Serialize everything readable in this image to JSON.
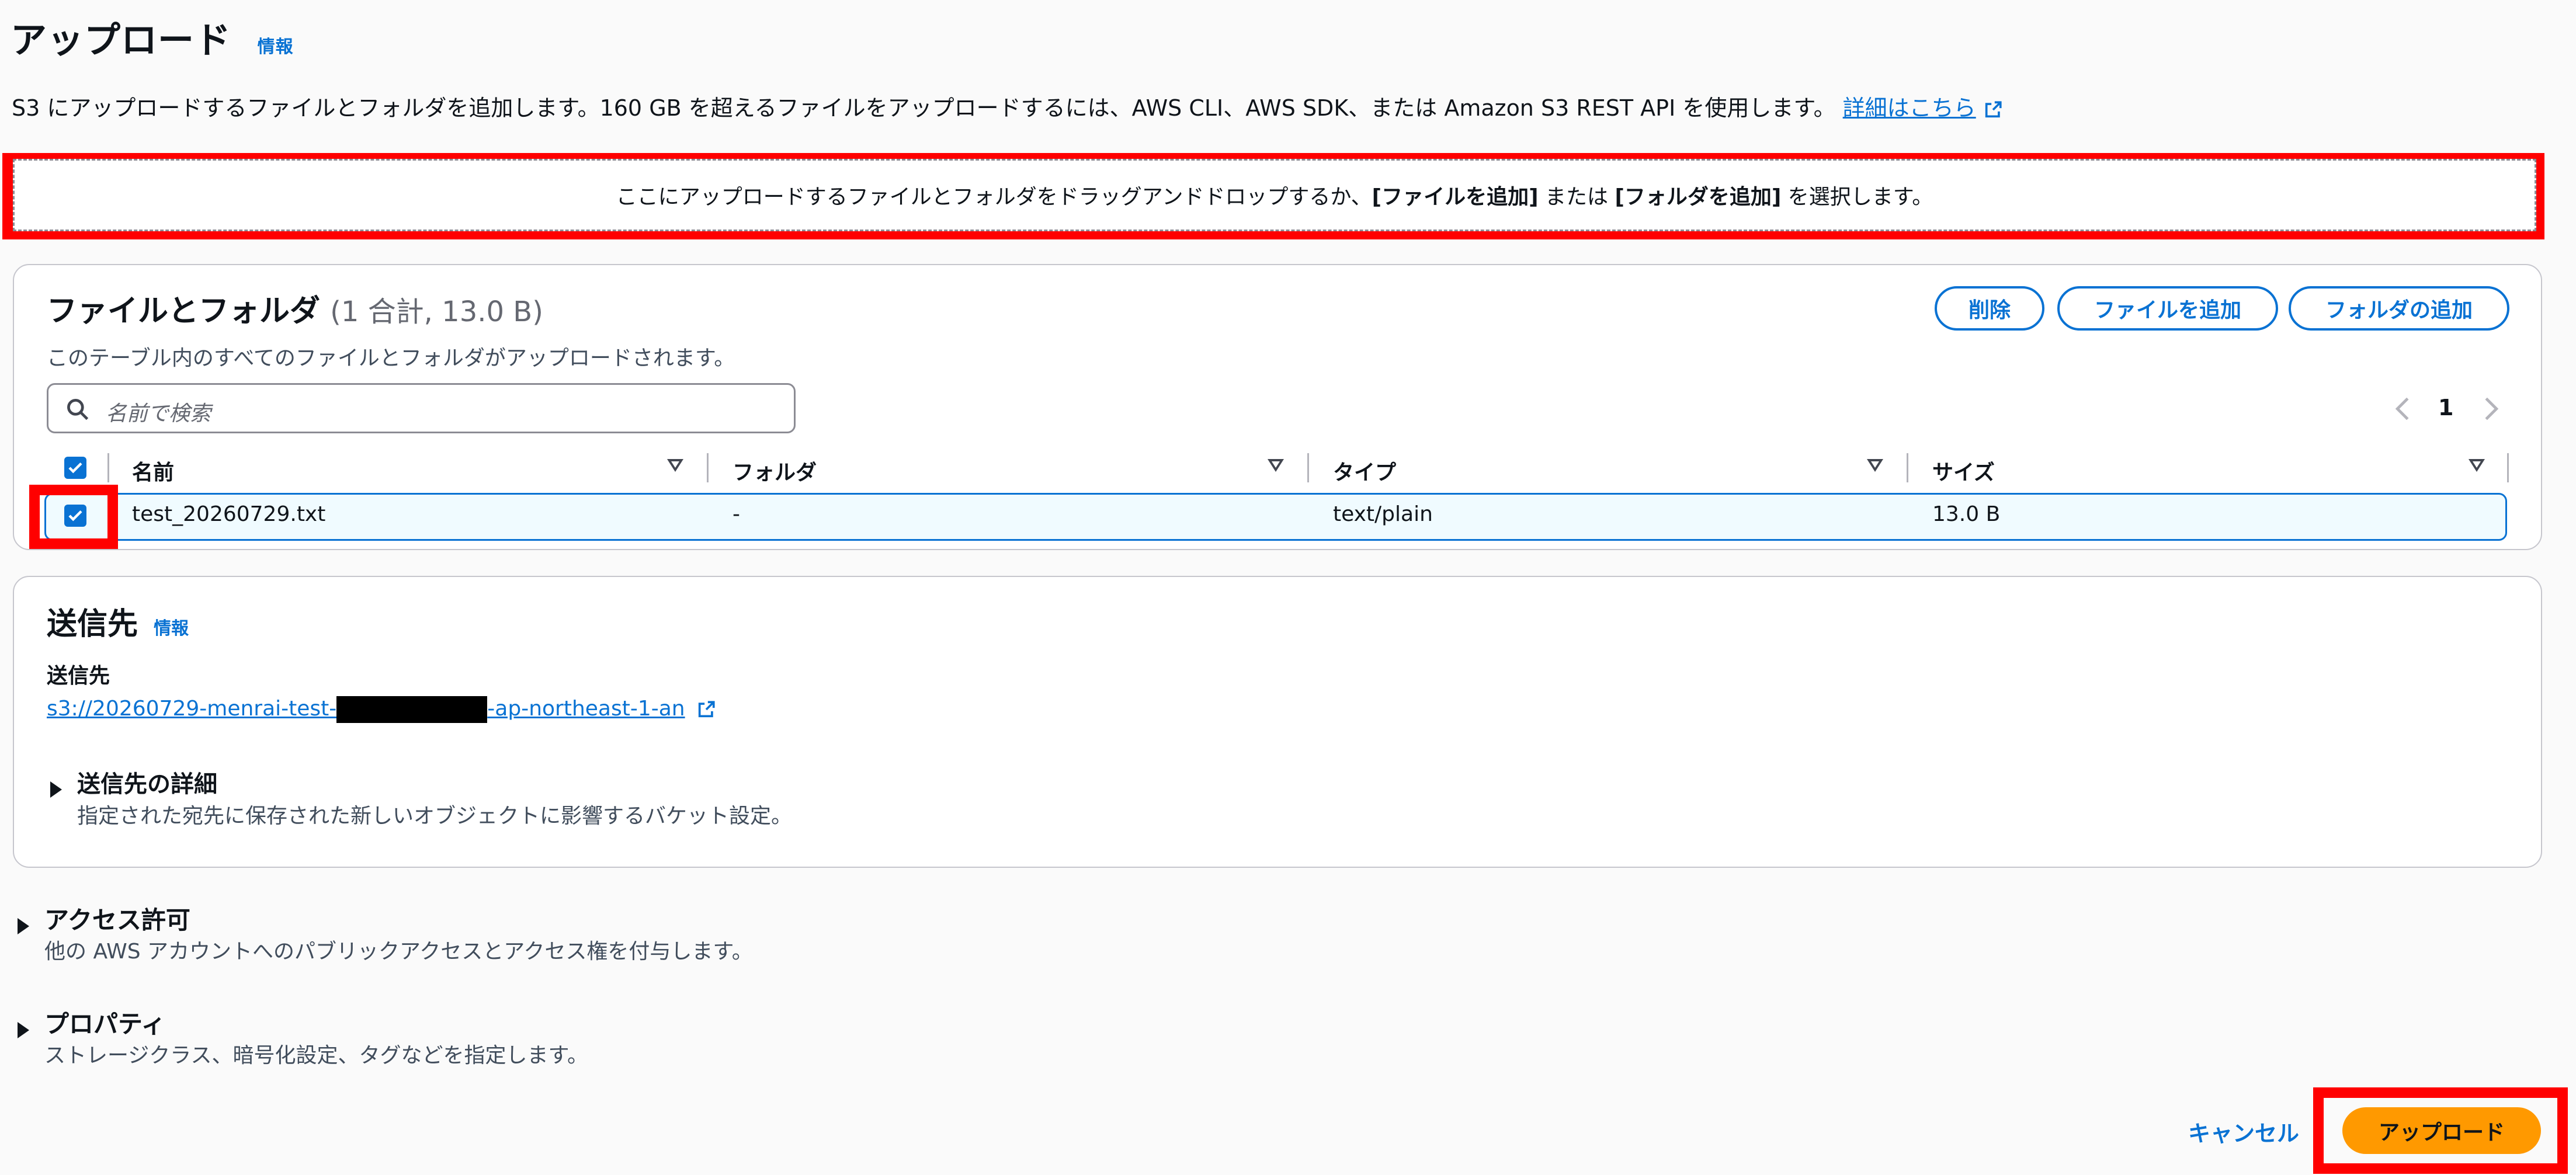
{
  "header": {
    "title": "アップロード",
    "info": "情報",
    "description": "S3 にアップロードするファイルとフォルダを追加します。160 GB を超えるファイルをアップロードするには、AWS CLI、AWS SDK、または Amazon S3 REST API を使用します。",
    "more_link": "詳細はこちら"
  },
  "dropzone": {
    "text_prefix": "ここにアップロードするファイルとフォルダをドラッグアンドドロップするか、",
    "add_files": "[ファイルを追加]",
    "mid": " または ",
    "add_folder": "[フォルダを追加]",
    "suffix": " を選択します。"
  },
  "files": {
    "title": "ファイルとフォルダ",
    "count": "(1 合計, 13.0 B)",
    "subtitle": "このテーブル内のすべてのファイルとフォルダがアップロードされます。",
    "actions": {
      "remove": "削除",
      "add_files": "ファイルを追加",
      "add_folder": "フォルダの追加"
    },
    "search_placeholder": "名前で検索",
    "page": "1",
    "columns": [
      "名前",
      "フォルダ",
      "タイプ",
      "サイズ"
    ],
    "rows": [
      {
        "name": "test_20260729.txt",
        "folder": "-",
        "type": "text/plain",
        "size": "13.0 B"
      }
    ]
  },
  "destination": {
    "title": "送信先",
    "info": "情報",
    "label": "送信先",
    "url_prefix": "s3://20260729-menrai-test-",
    "url_suffix": "-ap-northeast-1-an",
    "details_title": "送信先の詳細",
    "details_desc": "指定された宛先に保存された新しいオブジェクトに影響するバケット設定。"
  },
  "permissions": {
    "title": "アクセス許可",
    "desc": "他の AWS アカウントへのパブリックアクセスとアクセス権を付与します。"
  },
  "properties": {
    "title": "プロパティ",
    "desc": "ストレージクラス、暗号化設定、タグなどを指定します。"
  },
  "footer": {
    "cancel": "キャンセル",
    "upload": "アップロード"
  },
  "colors": {
    "accent": "#0972d3",
    "primary_button": "#ff9900",
    "highlight": "#ff0000"
  }
}
